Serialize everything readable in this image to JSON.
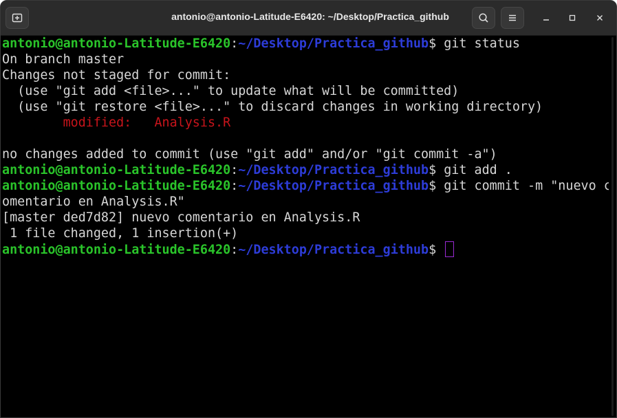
{
  "window": {
    "title": "antonio@antonio-Latitude-E6420: ~/Desktop/Practica_github"
  },
  "titlebar": {
    "new_tab_icon": "new-tab-icon",
    "search_icon": "search-icon",
    "menu_icon": "hamburger-menu-icon",
    "minimize_icon": "minimize-icon",
    "maximize_icon": "maximize-icon",
    "close_icon": "close-icon"
  },
  "terminal": {
    "prompt_user": "antonio@antonio-Latitude-E6420",
    "prompt_sep": ":",
    "prompt_path": "~/Desktop/Practica_github",
    "prompt_symbol": "$",
    "cmd1": " git status",
    "out1": "On branch master",
    "out2": "Changes not staged for commit:",
    "out3": "  (use \"git add <file>...\" to update what will be committed)",
    "out4": "  (use \"git restore <file>...\" to discard changes in working directory)",
    "out5_label": "        modified:   Analysis.R",
    "out6": "",
    "out7": "no changes added to commit (use \"git add\" and/or \"git commit -a\")",
    "cmd2": " git add .",
    "cmd3": " git commit -m \"nuevo c",
    "cmd3_wrap": "omentario en Analysis.R\"",
    "out8": "[master ded7d82] nuevo comentario en Analysis.R",
    "out9": " 1 file changed, 1 insertion(+)",
    "cmd4": " "
  },
  "colors": {
    "user": "#2ac42a",
    "path": "#2d3cd8",
    "text": "#d7d7d7",
    "modified": "#c8141b",
    "cursor": "#9a2ad4",
    "titlebar_bg": "#2b2b2b",
    "terminal_bg": "#000000"
  }
}
